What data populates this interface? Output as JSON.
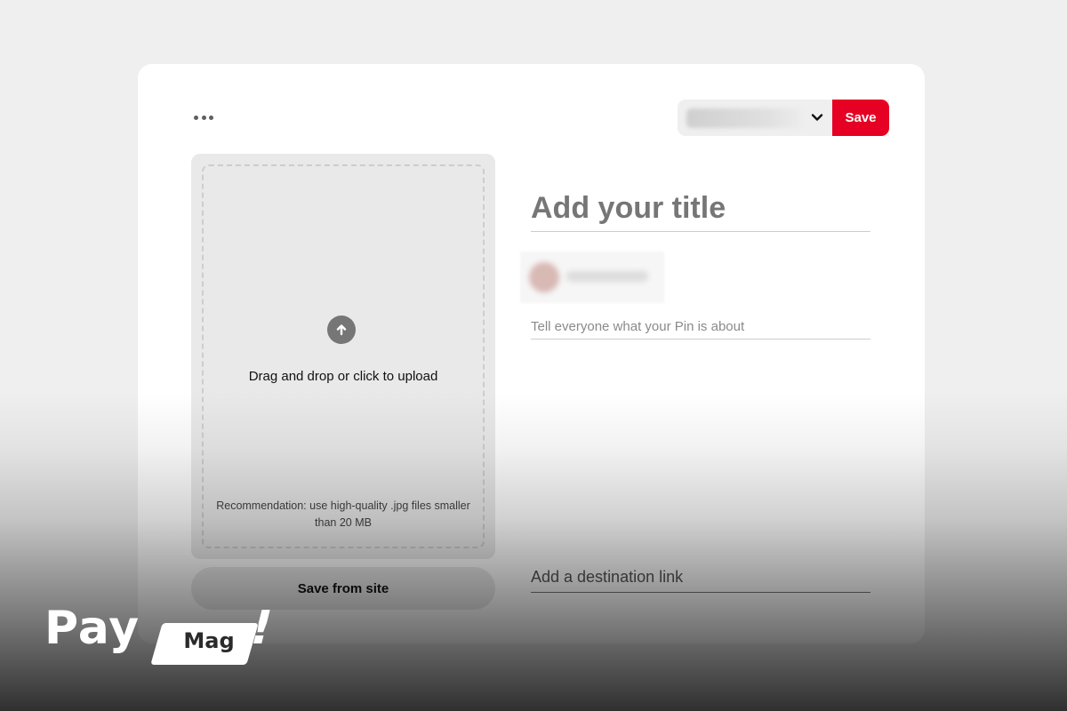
{
  "header": {
    "more_icon": "more-horizontal-icon",
    "board_dropdown_icon": "chevron-down-icon",
    "save_label": "Save",
    "save_color": "#e60023"
  },
  "upload": {
    "icon": "arrow-up-circle-icon",
    "prompt": "Drag and drop or click to upload",
    "recommendation": "Recommendation: use high-quality .jpg files smaller than 20 MB",
    "save_from_site_label": "Save from site"
  },
  "form": {
    "title_placeholder": "Add your title",
    "description_placeholder": "Tell everyone what your Pin is about",
    "link_placeholder": "Add a destination link"
  },
  "watermark": {
    "brand_part1": "Pay",
    "brand_part2": "Mag",
    "brand_part3": "!"
  }
}
